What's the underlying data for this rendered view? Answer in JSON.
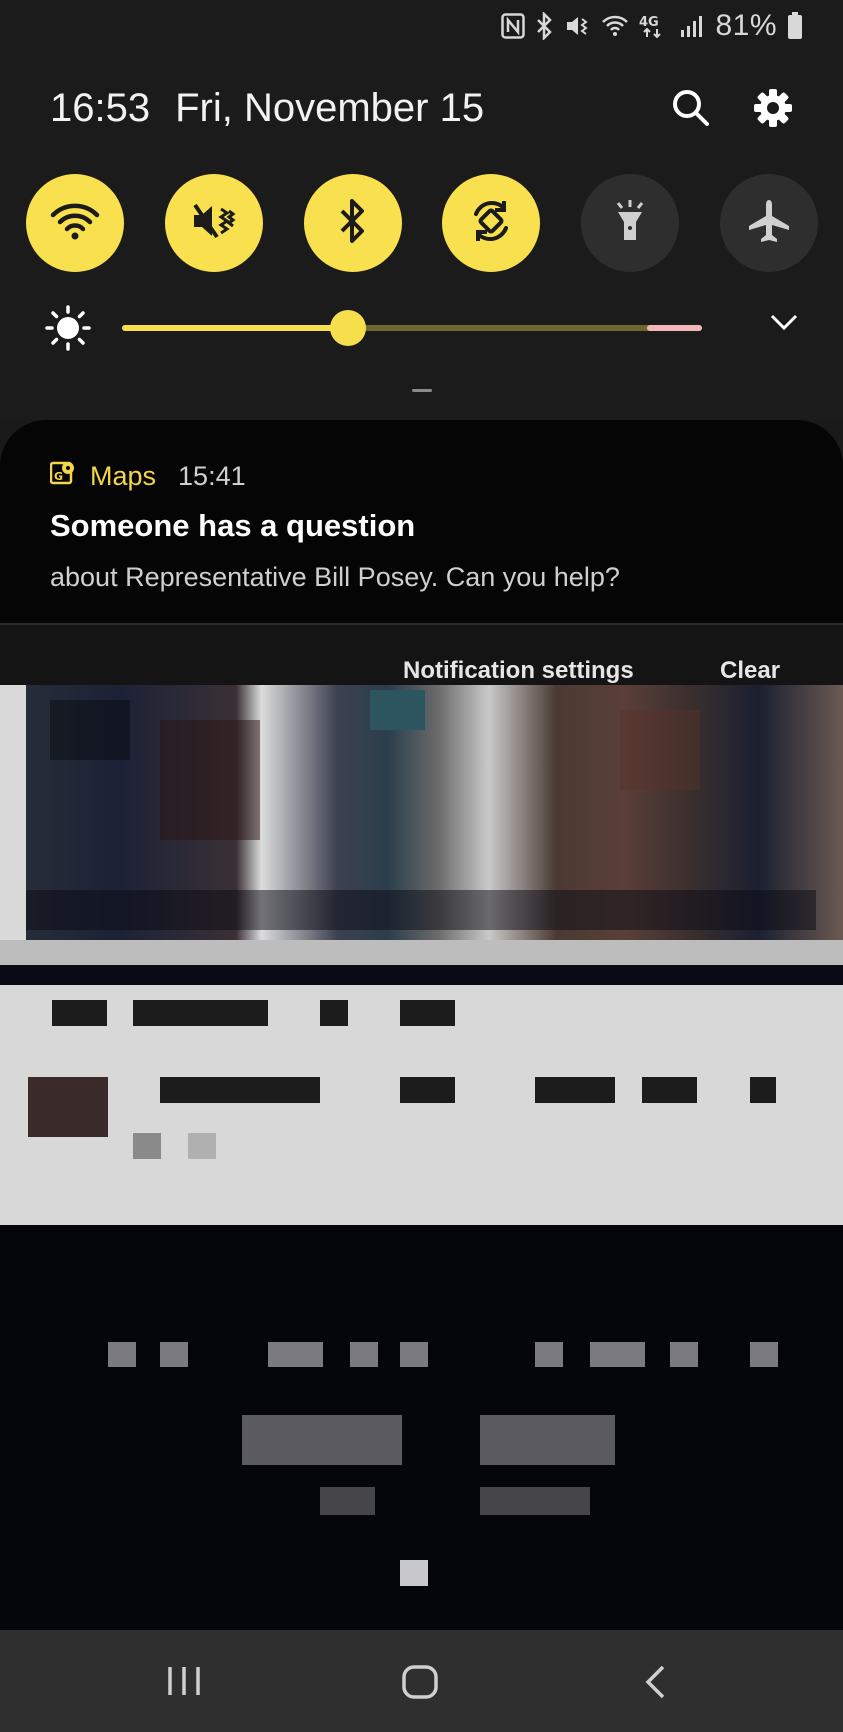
{
  "status_bar": {
    "icons": [
      "nfc-icon",
      "bluetooth-icon",
      "mute-vibrate-icon",
      "wifi-icon",
      "network-4g-icon",
      "cellular-signal-icon"
    ],
    "battery_percent": "81%"
  },
  "header": {
    "time": "16:53",
    "date": "Fri, November 15"
  },
  "quick_toggles": [
    {
      "name": "wifi",
      "icon": "wifi-icon",
      "state": "on"
    },
    {
      "name": "sound",
      "icon": "vibrate-icon",
      "state": "on"
    },
    {
      "name": "bluetooth",
      "icon": "bluetooth-icon",
      "state": "on"
    },
    {
      "name": "auto-rotate",
      "icon": "rotate-icon",
      "state": "on"
    },
    {
      "name": "flashlight",
      "icon": "flashlight-icon",
      "state": "off"
    },
    {
      "name": "airplane-mode",
      "icon": "airplane-icon",
      "state": "off"
    }
  ],
  "brightness": {
    "level": 0.39
  },
  "notification": {
    "app_name": "Maps",
    "time": "15:41",
    "title": "Someone has a question",
    "body": "about Representative Bill Posey. Can you help?"
  },
  "notification_actions": {
    "settings_label": "Notification settings",
    "clear_label": "Clear"
  },
  "colors": {
    "accent": "#f9e04f",
    "panel_bg": "#1b1b1b",
    "toggle_off": "#2e2e2e"
  }
}
